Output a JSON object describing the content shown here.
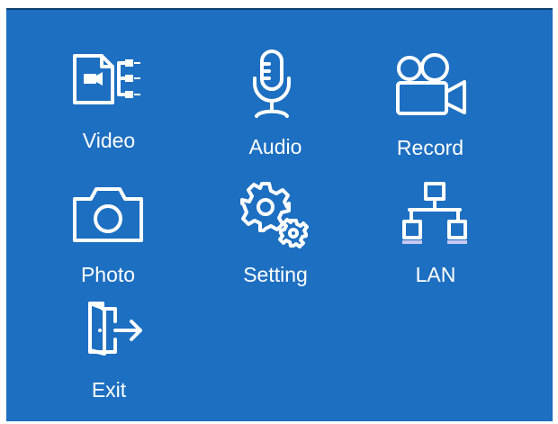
{
  "menu": {
    "items": [
      {
        "id": "video",
        "label": "Video",
        "icon": "video-file-icon"
      },
      {
        "id": "audio",
        "label": "Audio",
        "icon": "microphone-icon"
      },
      {
        "id": "record",
        "label": "Record",
        "icon": "movie-camera-icon"
      },
      {
        "id": "photo",
        "label": "Photo",
        "icon": "camera-icon"
      },
      {
        "id": "setting",
        "label": "Setting",
        "icon": "gears-icon"
      },
      {
        "id": "lan",
        "label": "LAN",
        "icon": "network-icon"
      },
      {
        "id": "exit",
        "label": "Exit",
        "icon": "exit-door-icon"
      }
    ]
  },
  "colors": {
    "background": "#1d6fc1",
    "foreground": "#ffffff",
    "lan_accent": "#c7c9f0"
  }
}
